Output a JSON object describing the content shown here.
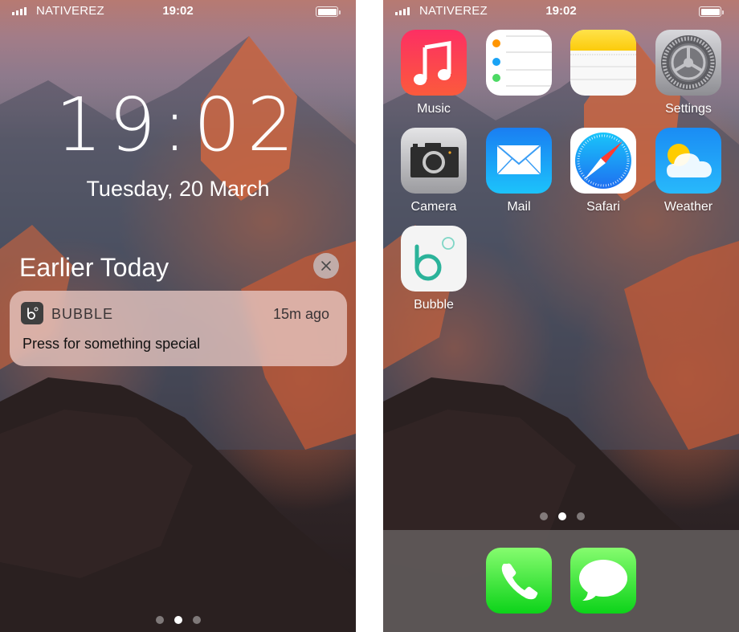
{
  "lock_screen": {
    "status_bar": {
      "carrier": "NATIVEREZ",
      "time": "19:02",
      "signal_bars": 4,
      "battery_level": 1.0
    },
    "clock": "19:02",
    "date": "Tuesday, 20 March",
    "section_title": "Earlier Today",
    "clear_icon": "close-icon",
    "notification": {
      "app_name": "BUBBLE",
      "time_ago": "15m ago",
      "message": "Press for something special",
      "icon": "bubble-icon"
    },
    "page_indicator": {
      "count": 3,
      "active": 2
    }
  },
  "home_screen": {
    "status_bar": {
      "carrier": "NATIVEREZ",
      "time": "19:02",
      "signal_bars": 4,
      "battery_level": 1.0
    },
    "apps": [
      {
        "label": "Music",
        "icon": "music-icon"
      },
      {
        "label": "",
        "icon": "reminders-icon"
      },
      {
        "label": "",
        "icon": "notes-icon"
      },
      {
        "label": "Settings",
        "icon": "settings-icon"
      },
      {
        "label": "Camera",
        "icon": "camera-icon"
      },
      {
        "label": "Mail",
        "icon": "mail-icon"
      },
      {
        "label": "Safari",
        "icon": "safari-icon"
      },
      {
        "label": "Weather",
        "icon": "weather-icon"
      },
      {
        "label": "Bubble",
        "icon": "bubble-icon"
      }
    ],
    "page_indicator": {
      "count": 3,
      "active": 2
    },
    "dock": [
      {
        "label": "",
        "icon": "phone-icon"
      },
      {
        "label": "",
        "icon": "messages-icon"
      }
    ]
  },
  "colors": {
    "bubble_teal": "#2bb39a",
    "music_red": "#fb3a5a",
    "mail_blue": "#1d8ff5",
    "phone_green": "#3ddc4e"
  }
}
